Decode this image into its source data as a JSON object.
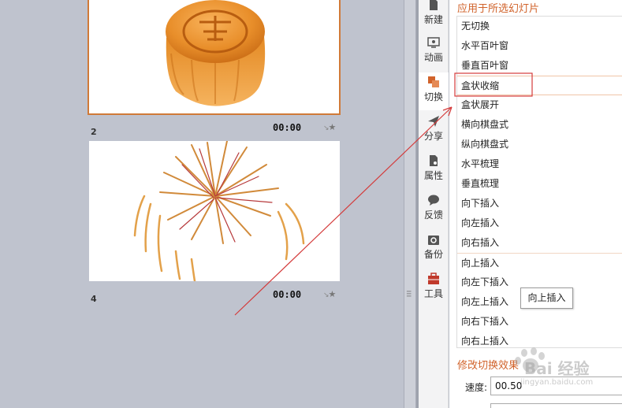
{
  "slides": [
    {
      "number": "",
      "time": "00:00",
      "image": "mooncake"
    },
    {
      "number": "2",
      "time": "00:00",
      "image": "fireworks"
    },
    {
      "number": "4",
      "time": "",
      "image": ""
    }
  ],
  "nav": [
    {
      "label": "新建",
      "icon": "new-doc-icon"
    },
    {
      "label": "动画",
      "icon": "animation-icon"
    },
    {
      "label": "切换",
      "icon": "transition-icon",
      "active": true
    },
    {
      "label": "分享",
      "icon": "share-icon"
    },
    {
      "label": "属性",
      "icon": "properties-icon"
    },
    {
      "label": "反馈",
      "icon": "feedback-icon"
    },
    {
      "label": "备份",
      "icon": "backup-icon"
    },
    {
      "label": "工具",
      "icon": "toolbox-icon"
    }
  ],
  "panel": {
    "title": "应用于所选幻灯片",
    "transitions": [
      "无切换",
      "水平百叶窗",
      "垂直百叶窗",
      "盒状收缩",
      "盒状展开",
      "横向棋盘式",
      "纵向棋盘式",
      "水平梳理",
      "垂直梳理",
      "向下插入",
      "向左插入",
      "向右插入",
      "向上插入",
      "向左下插入",
      "向左上插入",
      "向右下插入",
      "向右上插入"
    ],
    "selected": "盒状收缩",
    "tooltip": "向上插入",
    "modify_title": "修改切换效果",
    "speed_label": "速度:",
    "speed_value": "00.50"
  },
  "watermark": {
    "text": "Bai 经验",
    "subtext": "jingyan.baidu.com"
  },
  "colors": {
    "accent": "#d1632b",
    "annotation": "#d43b3b"
  }
}
